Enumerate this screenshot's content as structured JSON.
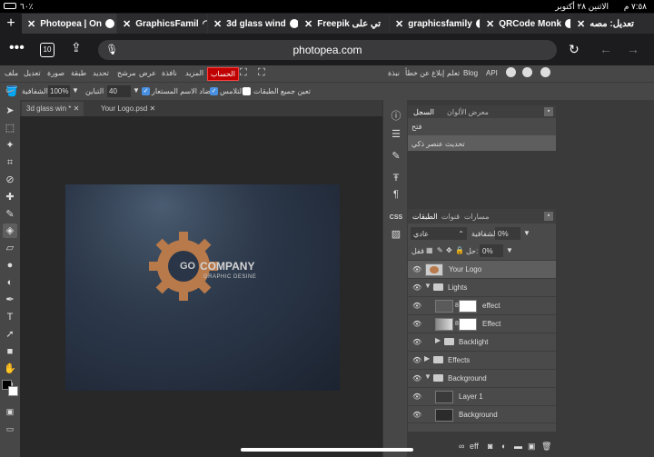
{
  "status": {
    "time": "٧:٥٨ م",
    "date": "الاثنين ٢٨ أكتوبر",
    "battery": "٦٠٪"
  },
  "browser_tabs": [
    {
      "title": "Photopea | On",
      "active": true
    },
    {
      "title": "GraphicsFamil"
    },
    {
      "title": "3d glass wind"
    },
    {
      "title": "Freepik ‏تي على"
    },
    {
      "title": "graphicsfamily"
    },
    {
      "title": "QRCode Monk"
    },
    {
      "title": "تعديل: مصه"
    }
  ],
  "address": {
    "url": "photopea.com",
    "tab_count": "10"
  },
  "menu": {
    "items": [
      "ملف",
      "تعديل",
      "صورة",
      "طبقة",
      "تحديد",
      "مرشح",
      "عرض",
      "نافذة",
      "المزيد"
    ],
    "account": "الحساب",
    "right_items": [
      "نبذة",
      "إبلاغ عن خطأ",
      "تعلم",
      "Blog",
      "API"
    ]
  },
  "options": {
    "opacity_label": "الشفافية",
    "opacity_value": "100%",
    "tolerance_label": "التباين",
    "tolerance_value": "40",
    "anti_alias": "التلامس",
    "contiguous": "مضاد الاسم المستعار",
    "all_layers": "تعين جميع الطبقات"
  },
  "doc_tabs": [
    {
      "title": "3d glass win",
      "mod": "*"
    },
    {
      "title": "Your Logo.psd"
    }
  ],
  "logo": {
    "brand_main": "COMPANY",
    "brand_sub": "GRAPHIC DESINE",
    "gear_letters": "GO"
  },
  "history_panel": {
    "tabs": [
      "السجل",
      "معرض الألوان"
    ],
    "items": [
      "فتح",
      "تحديث عنصر ذكي"
    ]
  },
  "layers_panel": {
    "tabs": [
      "الطبقات",
      "قنوات",
      "مسارات"
    ],
    "blend_mode": "عادي",
    "opacity_label": "الشفافية:",
    "opacity_value": "0%",
    "fill_label": "حل:",
    "fill_value": "0%",
    "lock_label": "قفل",
    "layers": [
      {
        "name": "Your Logo",
        "type": "smart",
        "selected": true
      },
      {
        "name": "Lights",
        "type": "folder-open"
      },
      {
        "name": "effect",
        "type": "adjust"
      },
      {
        "name": "Effect",
        "type": "adjust"
      },
      {
        "name": "Backlight",
        "type": "folder-closed"
      },
      {
        "name": "Effects",
        "type": "folder-closed"
      },
      {
        "name": "Background",
        "type": "folder-open"
      },
      {
        "name": "Layer 1",
        "type": "pixel"
      },
      {
        "name": "Background",
        "type": "pixel"
      }
    ],
    "footer_fx": "eff"
  },
  "colors": {
    "accent": "#c00000",
    "checkbox": "#4a90e2",
    "gear": "#b87a4b"
  }
}
